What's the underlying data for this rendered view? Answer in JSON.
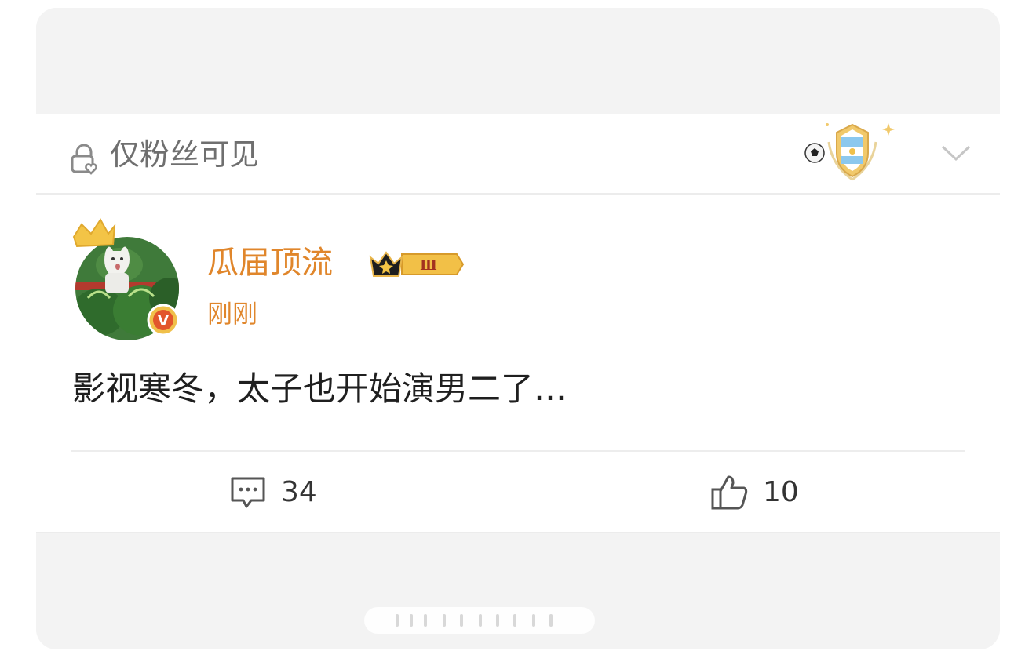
{
  "colors": {
    "accent": "#e0862b",
    "muted_text": "#6f6f6f",
    "body_text": "#1f1f1f",
    "background": "#f3f3f3",
    "card": "#ffffff"
  },
  "visibility": {
    "label": "仅粉丝可见",
    "icon": "lock-heart-icon"
  },
  "header": {
    "medal_icon": "argentina-football-medal-icon",
    "expand_icon": "chevron-down-icon"
  },
  "post": {
    "author": {
      "name": "瓜届顶流",
      "level_badge": "Ⅲ",
      "verified_mark": "V",
      "avatar_icon": "avatar-cat-watermelons"
    },
    "time": "刚刚",
    "text": "影视寒冬，太子也开始演男二了…",
    "actions": {
      "comments": {
        "icon": "comment-icon",
        "count": "34"
      },
      "likes": {
        "icon": "thumbs-up-icon",
        "count": "10"
      }
    }
  }
}
